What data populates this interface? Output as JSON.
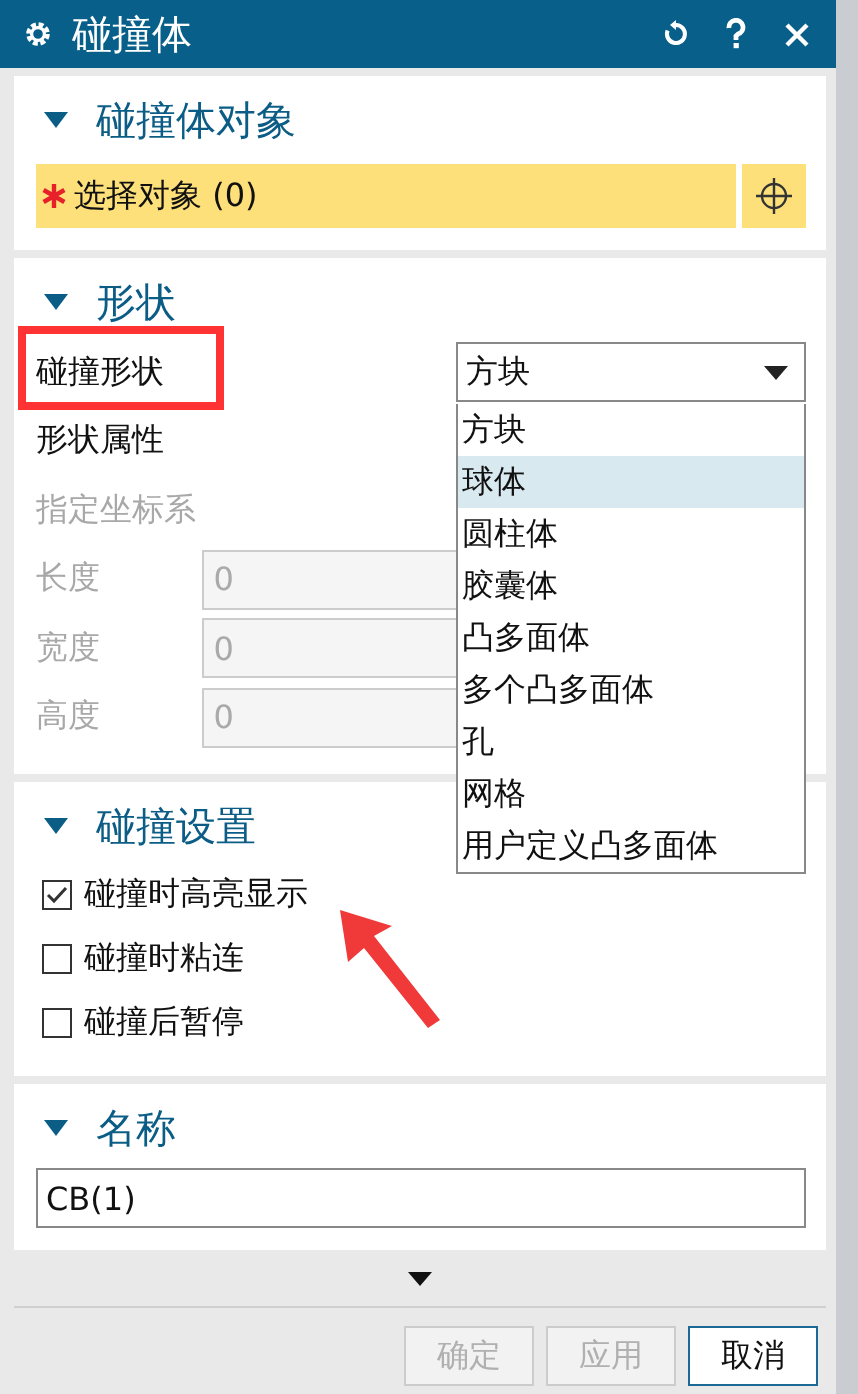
{
  "window": {
    "title": "碰撞体"
  },
  "sections": [
    {
      "kind": "select",
      "title": "碰撞体对象",
      "expanded": true,
      "select_label": "选择对象 (0)",
      "required": true
    },
    {
      "kind": "shape",
      "title": "形状",
      "expanded": true,
      "shape_label": "碰撞形状",
      "shape_value": "方块",
      "dropdown_open": true,
      "options": [
        {
          "label": "方块",
          "selected": false
        },
        {
          "label": "球体",
          "selected": true
        },
        {
          "label": "圆柱体",
          "selected": false
        },
        {
          "label": "胶囊体",
          "selected": false
        },
        {
          "label": "凸多面体",
          "selected": false
        },
        {
          "label": "多个凸多面体",
          "selected": false
        },
        {
          "label": "孔",
          "selected": false
        },
        {
          "label": "网格",
          "selected": false
        },
        {
          "label": "用户定义凸多面体",
          "selected": false
        }
      ],
      "properties_label": "形状属性",
      "csys_label": "指定坐标系",
      "csys_disabled": true,
      "fields": [
        {
          "label": "长度",
          "value": "0",
          "disabled": true
        },
        {
          "label": "宽度",
          "value": "0",
          "disabled": true
        },
        {
          "label": "高度",
          "value": "0",
          "disabled": true
        }
      ]
    },
    {
      "kind": "checks",
      "title": "碰撞设置",
      "expanded": true,
      "options": [
        {
          "label": "碰撞时高亮显示",
          "checked": true
        },
        {
          "label": "碰撞时粘连",
          "checked": false
        },
        {
          "label": "碰撞后暂停",
          "checked": false
        }
      ]
    },
    {
      "kind": "name",
      "title": "名称",
      "expanded": true,
      "value": "CB(1)"
    }
  ],
  "buttons": [
    {
      "label": "确定",
      "disabled": true
    },
    {
      "label": "应用",
      "disabled": true
    },
    {
      "label": "取消",
      "disabled": false
    }
  ]
}
